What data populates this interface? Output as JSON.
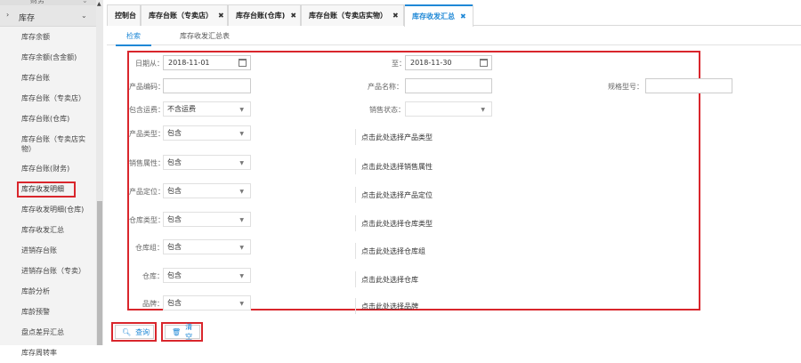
{
  "sidebar": {
    "prev_label": "财务",
    "group_label": "库存",
    "items": [
      {
        "label": "库存余额"
      },
      {
        "label": "库存余额(含金额)"
      },
      {
        "label": "库存台账"
      },
      {
        "label": "库存台账（专卖店）"
      },
      {
        "label": "库存台账(仓库)"
      },
      {
        "label": "库存台账（专卖店实物）"
      },
      {
        "label": "库存台账(财务)"
      },
      {
        "label": "库存收发明细"
      },
      {
        "label": "库存收发明细(仓库)"
      },
      {
        "label": "库存收发汇总"
      },
      {
        "label": "进销存台账"
      },
      {
        "label": "进销存台账（专卖）"
      },
      {
        "label": "库龄分析"
      },
      {
        "label": "库龄预警"
      },
      {
        "label": "盘点差异汇总"
      },
      {
        "label": "库存周转率"
      }
    ]
  },
  "tabs": [
    {
      "label": "控制台"
    },
    {
      "label": "库存台账（专卖店）"
    },
    {
      "label": "库存台账(仓库)"
    },
    {
      "label": "库存台账（专卖店实物）"
    },
    {
      "label": "库存收发汇总"
    }
  ],
  "subtabs": [
    "检索",
    "库存收发汇总表"
  ],
  "form": {
    "date_from_label": "日期从：",
    "date_from_value": "2018-11-01",
    "date_to_label": "至：",
    "date_to_value": "2018-11-30",
    "product_code_label": "产品编码：",
    "product_name_label": "产品名称：",
    "spec_label": "规格型号：",
    "freight_label": "包含运费：",
    "freight_value": "不含运费",
    "sales_status_label": "销售状态：",
    "sales_status_value": "",
    "product_type_label": "产品类型：",
    "product_type_value": "包含",
    "product_type_picker": "点击此处选择产品类型",
    "sales_attr_label": "销售属性：",
    "sales_attr_value": "包含",
    "sales_attr_picker": "点击此处选择销售属性",
    "product_pos_label": "产品定位：",
    "product_pos_value": "包含",
    "product_pos_picker": "点击此处选择产品定位",
    "wh_type_label": "仓库类型：",
    "wh_type_value": "包含",
    "wh_type_picker": "点击此处选择仓库类型",
    "wh_group_label": "仓库组：",
    "wh_group_value": "包含",
    "wh_group_picker": "点击此处选择仓库组",
    "warehouse_label": "仓库：",
    "warehouse_value": "包含",
    "warehouse_picker": "点击此处选择仓库",
    "brand_label": "品牌：",
    "brand_value": "包含",
    "brand_picker": "点击此处选择品牌"
  },
  "buttons": {
    "query": "查询",
    "clear": "清空"
  },
  "colors": {
    "accent": "#1f88d6",
    "highlight": "#d9262c"
  }
}
